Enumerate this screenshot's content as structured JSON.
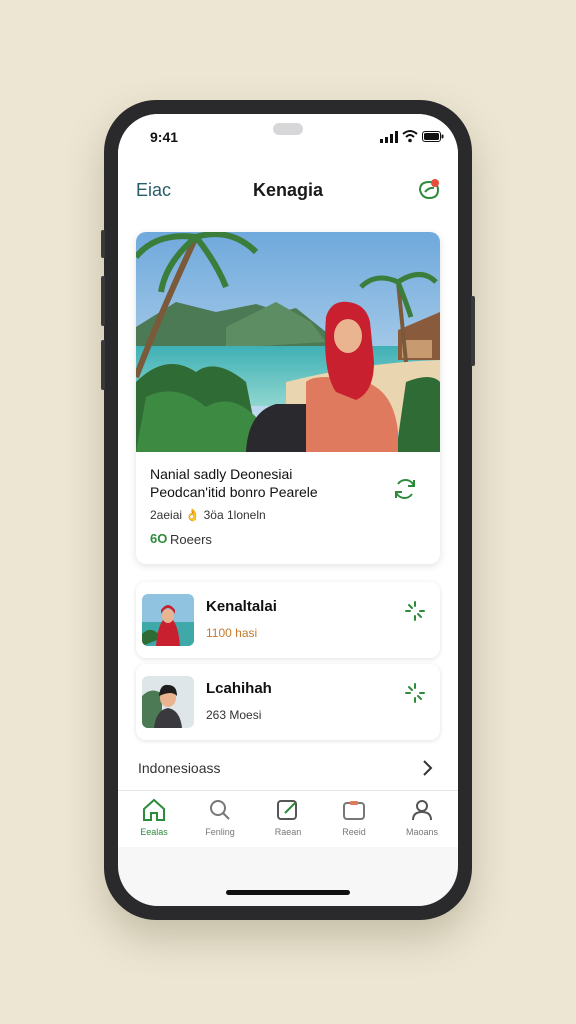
{
  "status_bar": {
    "time": "9:41"
  },
  "header": {
    "left_label": "Eiac",
    "title": "Kenagia",
    "action_icon": "leaf-notification-icon",
    "accent": "#2e8b3c",
    "badge_color": "#e74c3c"
  },
  "feature": {
    "title": "Nanial sadly Deonesiai",
    "subtitle": "Peodcan'itid bonro Pearele",
    "meta": "2aeiai 👌 3öa 1loneln",
    "likes_icon": "6O",
    "likes_label": "Roeers",
    "action_icon": "refresh-icon"
  },
  "list": [
    {
      "name": "Kenaltalai",
      "meta": "1100 hasi",
      "action_icon": "loading-icon"
    },
    {
      "name": "Lcahihah",
      "meta": "263 Moesi",
      "action_icon": "loading-icon"
    }
  ],
  "more": {
    "label": "Indonesioass"
  },
  "tabs": [
    {
      "label": "Eealas",
      "icon": "home-icon",
      "active": true
    },
    {
      "label": "Fenling",
      "icon": "search-icon",
      "active": false
    },
    {
      "label": "Raean",
      "icon": "edit-icon",
      "active": false
    },
    {
      "label": "Reeid",
      "icon": "folder-icon",
      "active": false
    },
    {
      "label": "Maoans",
      "icon": "profile-icon",
      "active": false
    }
  ]
}
